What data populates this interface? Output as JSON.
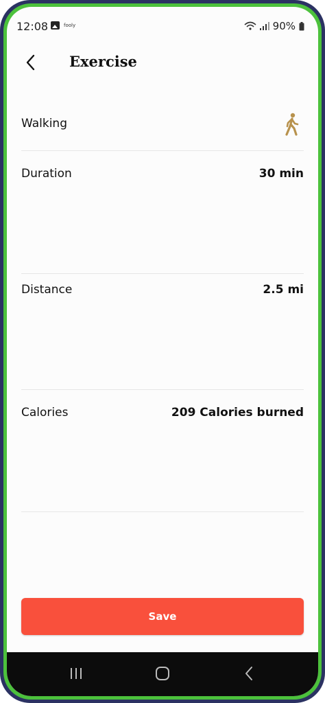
{
  "status_bar": {
    "time": "12:08",
    "app_mini_label": "fooly",
    "battery": "90%"
  },
  "header": {
    "title": "Exercise"
  },
  "exercise": {
    "activity_label": "Walking",
    "activity_icon": "walking-person-icon",
    "rows": [
      {
        "label": "Duration",
        "value": "30 min"
      },
      {
        "label": "Distance",
        "value": "2.5 mi"
      },
      {
        "label": "Calories",
        "value": "209 Calories burned"
      }
    ]
  },
  "footer": {
    "save_label": "Save"
  },
  "colors": {
    "accent": "#f9503c",
    "icon_gold": "#b8924d",
    "frame_outer": "#2b3262",
    "frame_inner": "#4cc13c"
  }
}
